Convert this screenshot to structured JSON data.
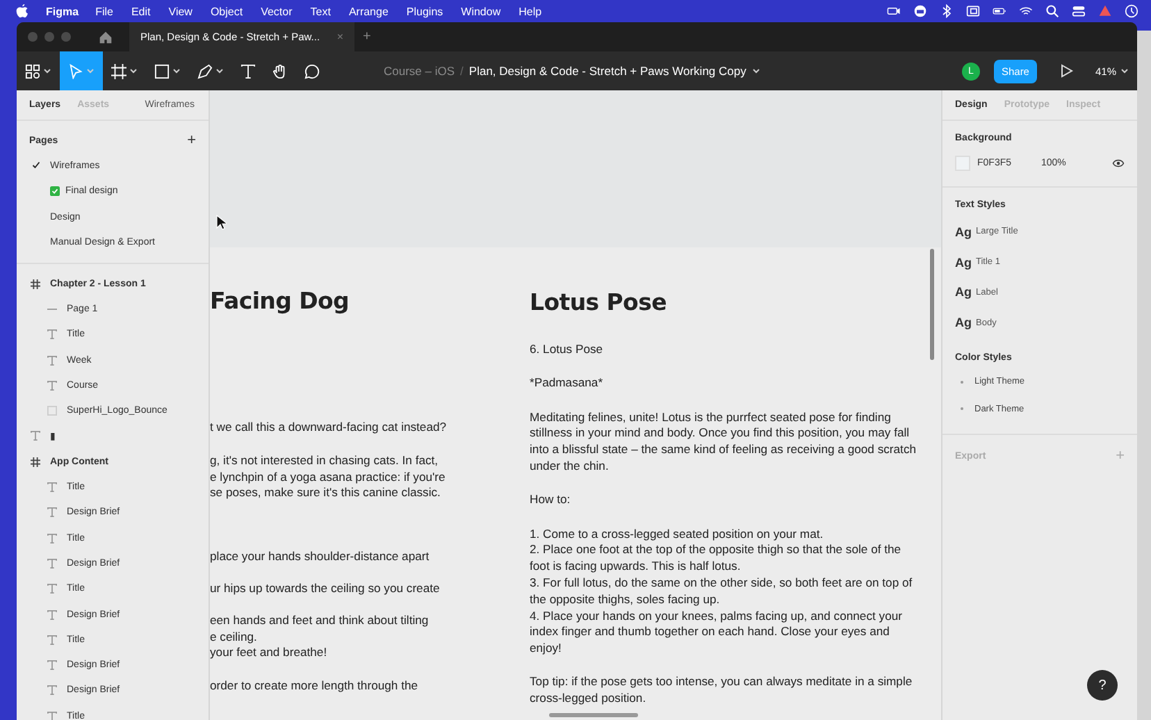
{
  "menubar": {
    "app": "Figma",
    "menus": [
      "File",
      "Edit",
      "View",
      "Object",
      "Vector",
      "Text",
      "Arrange",
      "Plugins",
      "Window",
      "Help"
    ]
  },
  "tab": {
    "title": "Plan, Design & Code - Stretch + Paw...",
    "close": "×",
    "new": "+"
  },
  "toolbar": {
    "tools": [
      {
        "kind": "menu",
        "selected": false
      },
      {
        "kind": "move",
        "selected": true
      },
      {
        "kind": "frame",
        "selected": false
      },
      {
        "kind": "shape",
        "selected": false
      },
      {
        "kind": "pen",
        "selected": false
      },
      {
        "kind": "text",
        "selected": false
      },
      {
        "kind": "hand",
        "selected": false
      },
      {
        "kind": "comment",
        "selected": false
      }
    ],
    "project": "Course – iOS",
    "separator": "/",
    "file": "Plan, Design & Code - Stretch + Paws Working Copy",
    "avatar": "L",
    "share": "Share",
    "zoom": "41%"
  },
  "left_panel": {
    "tabs": [
      {
        "label": "Layers",
        "selected": true
      },
      {
        "label": "Assets",
        "selected": false
      }
    ],
    "page_switch": "Wireframes",
    "pages_title": "Pages",
    "add": "+",
    "pages": [
      {
        "label": "Wireframes",
        "selected": true,
        "kind": "plain"
      },
      {
        "label": "Final design",
        "selected": false,
        "kind": "marked"
      },
      {
        "label": "Design",
        "selected": false,
        "kind": "plain"
      },
      {
        "label": "Manual Design & Export",
        "selected": false,
        "kind": "plain"
      }
    ],
    "layers": [
      {
        "name": "Chapter 2 - Lesson 1",
        "kind": "frame",
        "children": [
          {
            "name": "Page 1",
            "kind": "line"
          },
          {
            "name": "Title",
            "kind": "text"
          },
          {
            "name": "Week",
            "kind": "text"
          },
          {
            "name": "Course",
            "kind": "text"
          },
          {
            "name": "SuperHi_Logo_Bounce",
            "kind": "image"
          }
        ]
      },
      {
        "name": "▮",
        "kind": "text"
      },
      {
        "name": "App Content",
        "kind": "frame",
        "children": [
          {
            "name": "Title",
            "kind": "text"
          },
          {
            "name": "Design Brief",
            "kind": "text"
          },
          {
            "name": "Title",
            "kind": "text"
          },
          {
            "name": "Design Brief",
            "kind": "text"
          },
          {
            "name": "Title",
            "kind": "text"
          },
          {
            "name": "Design Brief",
            "kind": "text"
          },
          {
            "name": "Title",
            "kind": "text"
          },
          {
            "name": "Design Brief",
            "kind": "text"
          },
          {
            "name": "Design Brief",
            "kind": "text"
          },
          {
            "name": "Title",
            "kind": "text"
          }
        ]
      }
    ]
  },
  "canvas": {
    "left_column": {
      "title": "Facing Dog",
      "paragraphs": [
        "t we call this a downward-facing cat instead?",
        "g, it's not interested in chasing cats. In fact,\ne lynchpin of a yoga asana practice: if you're\nse poses, make sure it's this canine classic.",
        "place your hands shoulder-distance apart",
        "ur hips up towards the ceiling so you create",
        "een hands and feet and think about tilting\ne ceiling.\nyour feet and breathe!",
        "order to create more length through the"
      ]
    },
    "right_column": {
      "title": "Lotus Pose",
      "paragraphs": [
        "6. Lotus Pose",
        "*Padmasana*",
        "Meditating felines, unite! Lotus is the purrfect seated pose for finding\nstillness in your mind and body. Once you find this position, you may fall\ninto a blissful state – the same kind of feeling as receiving a good scratch\nunder the chin.",
        "How to:",
        "1. Come to a cross-legged seated position on your mat.\n2. Place one foot at the top of the opposite thigh so that the sole of the\nfoot is facing upwards. This is half lotus.\n3. For full lotus, do the same on the other side, so both feet are on top of\nthe opposite thighs, soles facing up.\n4. Place your hands on your knees, palms facing up, and connect your\nindex finger and thumb together on each hand. Close your eyes and\nenjoy!",
        "Top tip: if the pose gets too intense, you can always meditate in a simple\ncross-legged position."
      ]
    }
  },
  "right_panel": {
    "tabs": [
      {
        "label": "Design",
        "selected": true
      },
      {
        "label": "Prototype",
        "selected": false
      },
      {
        "label": "Inspect",
        "selected": false
      }
    ],
    "background": {
      "title": "Background",
      "color": "#f0f3f5",
      "hex": "F0F3F5",
      "opacity": "100%"
    },
    "text_styles": {
      "title": "Text Styles",
      "items": [
        {
          "sample": "Ag",
          "name": "Large Title"
        },
        {
          "sample": "Ag",
          "name": "Title 1"
        },
        {
          "sample": "Ag",
          "name": "Label"
        },
        {
          "sample": "Ag",
          "name": "Body"
        }
      ]
    },
    "color_styles": {
      "title": "Color Styles",
      "items": [
        "Light Theme",
        "Dark Theme"
      ]
    },
    "export": {
      "title": "Export",
      "add": "+"
    }
  },
  "help": "?"
}
